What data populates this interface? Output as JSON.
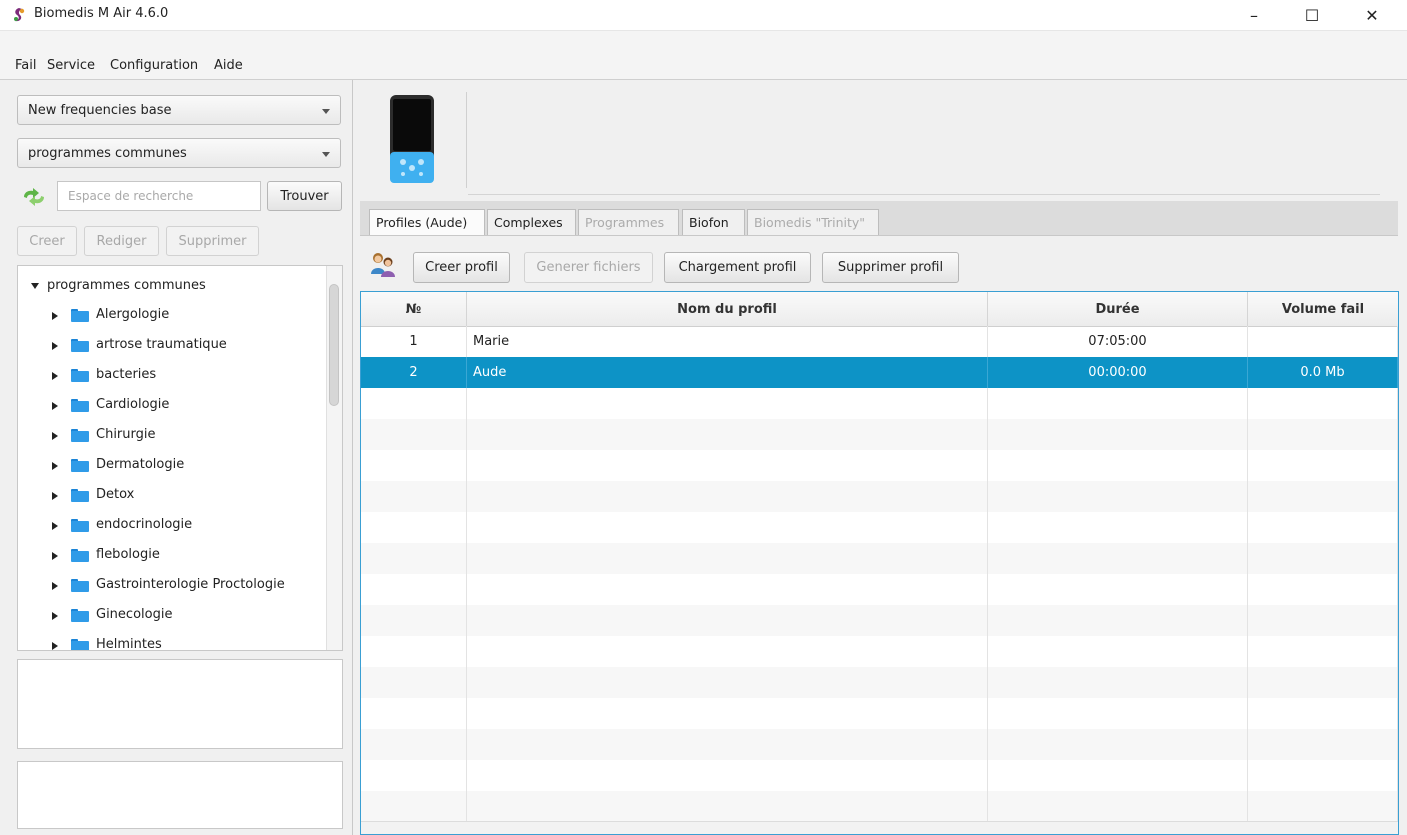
{
  "window": {
    "title": "Biomedis M Air 4.6.0",
    "minimize": "–",
    "maximize": "☐",
    "close": "✕"
  },
  "menu": [
    "Fail",
    "Service",
    "Configuration",
    "Aide"
  ],
  "left": {
    "base_combo": "New frequencies base",
    "section_combo": "programmes communes",
    "search_placeholder": "Espace de recherche",
    "find_button": "Trouver",
    "actions": {
      "create": "Creer",
      "edit": "Rediger",
      "delete": "Supprimer"
    },
    "tree_root": "programmes communes",
    "tree_items": [
      "Alergologie",
      "artrose traumatique",
      "bacteries",
      "Cardiologie",
      "Chirurgie",
      "Dermatologie",
      "Detox",
      "endocrinologie",
      "flebologie",
      "Gastrointerologie Proctologie",
      "Ginecologie",
      "Helmintes"
    ]
  },
  "tabs": [
    {
      "label": "Profiles (Aude)",
      "state": "active"
    },
    {
      "label": "Complexes",
      "state": "normal"
    },
    {
      "label": "Programmes",
      "state": "disabled"
    },
    {
      "label": "Biofon",
      "state": "normal"
    },
    {
      "label": "Biomedis \"Trinity\"",
      "state": "disabled"
    }
  ],
  "toolbar": {
    "create_profile": "Creer profil",
    "generate_files": "Generer fichiers",
    "load_profile": "Chargement profil",
    "delete_profile": "Supprimer profil"
  },
  "table": {
    "headers": {
      "num": "№",
      "name": "Nom du profil",
      "duration": "Durée",
      "size": "Volume fail"
    },
    "rows": [
      {
        "num": "1",
        "name": "Marie",
        "duration": "07:05:00",
        "size": ""
      },
      {
        "num": "2",
        "name": "Aude",
        "duration": "00:00:00",
        "size": "0.0 Mb"
      }
    ],
    "selected_row": 2
  },
  "colors": {
    "selection": "#0d93c6",
    "folder": "#2f9be8",
    "device_screen": "#0a0a0a",
    "device_keys": "#3fb0f0"
  },
  "icons": [
    "refresh-icon",
    "folder-icon",
    "profile-users-icon",
    "device-icon",
    "app-logo-icon"
  ]
}
